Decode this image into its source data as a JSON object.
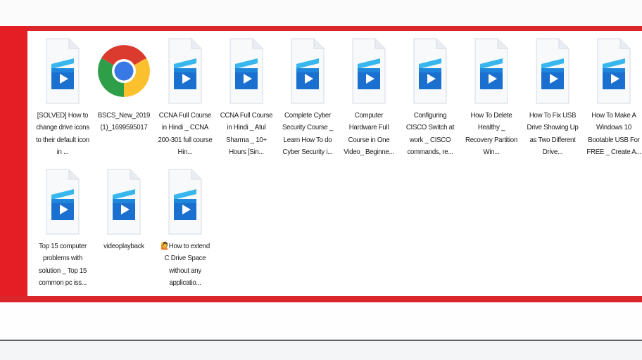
{
  "window": {
    "colors": {
      "frame_red": "#d9262b",
      "background": "#ffffff",
      "video_icon_blue": "#1a73d1"
    }
  },
  "files": [
    {
      "name": "[SOLVED] How to change drive icons to their default icon in ...",
      "icon": "video-file-icon"
    },
    {
      "name": "BSCS_New_2019 (1)_1699595017",
      "icon": "chrome-icon"
    },
    {
      "name": "CCNA Full Course in Hindi _ CCNA 200-301 full course Hin...",
      "icon": "video-file-icon"
    },
    {
      "name": "CCNA Full Course in Hindi _ Atul Sharma _ 10+ Hours [Sin...",
      "icon": "video-file-icon"
    },
    {
      "name": "Complete Cyber Security Course _ Learn How To do Cyber Security i...",
      "icon": "video-file-icon"
    },
    {
      "name": "Computer Hardware Full Course in One Video_ Beginne...",
      "icon": "video-file-icon"
    },
    {
      "name": "Configuring CISCO Switch at work _ CISCO commands, re...",
      "icon": "video-file-icon"
    },
    {
      "name": "How To Delete Healthy _ Recovery Partition Win...",
      "icon": "video-file-icon"
    },
    {
      "name": "How To Fix USB Drive Showing Up as Two Different Drive...",
      "icon": "video-file-icon"
    },
    {
      "name": "How To Make A Windows 10 Bootable USB For FREE _ Create A...",
      "icon": "video-file-icon"
    },
    {
      "name": "Top 15 computer problems with solution _ Top 15 common pc iss...",
      "icon": "video-file-icon"
    },
    {
      "name": "videoplayback",
      "icon": "video-file-icon"
    },
    {
      "name": "🙋How to extend C Drive Space without any applicatio...",
      "icon": "video-file-icon"
    }
  ]
}
